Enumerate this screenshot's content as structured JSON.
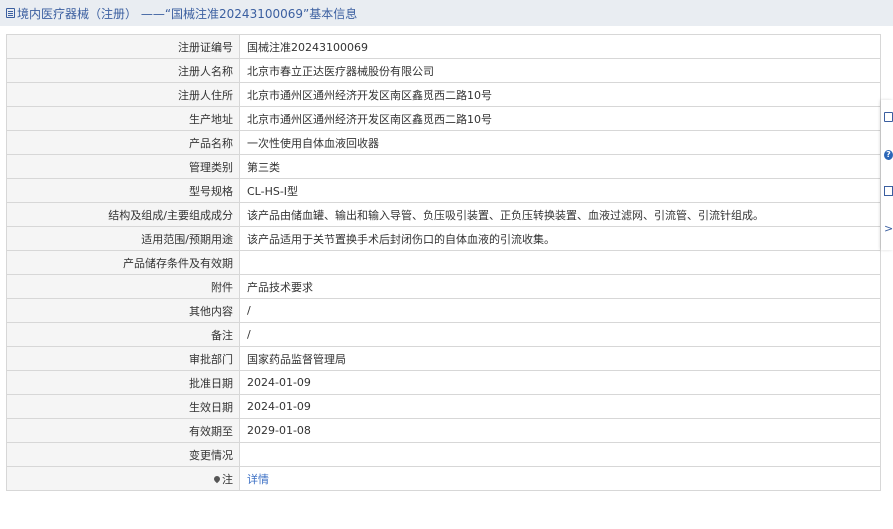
{
  "header": {
    "icon": "document-icon",
    "title": "境内医疗器械（注册） ——“国械注准20243100069”基本信息"
  },
  "rows": [
    {
      "label": "注册证编号",
      "value": "国械注准20243100069"
    },
    {
      "label": "注册人名称",
      "value": "北京市春立正达医疗器械股份有限公司"
    },
    {
      "label": "注册人住所",
      "value": "北京市通州区通州经济开发区南区鑫觅西二路10号"
    },
    {
      "label": "生产地址",
      "value": "北京市通州区通州经济开发区南区鑫觅西二路10号"
    },
    {
      "label": "产品名称",
      "value": "一次性使用自体血液回收器"
    },
    {
      "label": "管理类别",
      "value": "第三类"
    },
    {
      "label": "型号规格",
      "value": "CL-HS-Ⅰ型"
    },
    {
      "label": "结构及组成/主要组成成分",
      "value": "该产品由储血罐、输出和输入导管、负压吸引装置、正负压转换装置、血液过滤网、引流管、引流针组成。"
    },
    {
      "label": "适用范围/预期用途",
      "value": "该产品适用于关节置换手术后封闭伤口的自体血液的引流收集。"
    },
    {
      "label": "产品储存条件及有效期",
      "value": ""
    },
    {
      "label": "附件",
      "value": "产品技术要求"
    },
    {
      "label": "其他内容",
      "value": "/"
    },
    {
      "label": "备注",
      "value": "/"
    },
    {
      "label": "审批部门",
      "value": "国家药品监督管理局"
    },
    {
      "label": "批准日期",
      "value": "2024-01-09"
    },
    {
      "label": "生效日期",
      "value": "2024-01-09"
    },
    {
      "label": "有效期至",
      "value": "2029-01-08"
    },
    {
      "label": "变更情况",
      "value": ""
    },
    {
      "label": "注",
      "value": "详情",
      "icon": "pin-icon"
    }
  ],
  "side_toolbar": {
    "icons": [
      "edit-icon",
      "help-icon",
      "copy-icon",
      "chevron-right-icon"
    ],
    "help_glyph": "?",
    "chevron_glyph": ">"
  }
}
